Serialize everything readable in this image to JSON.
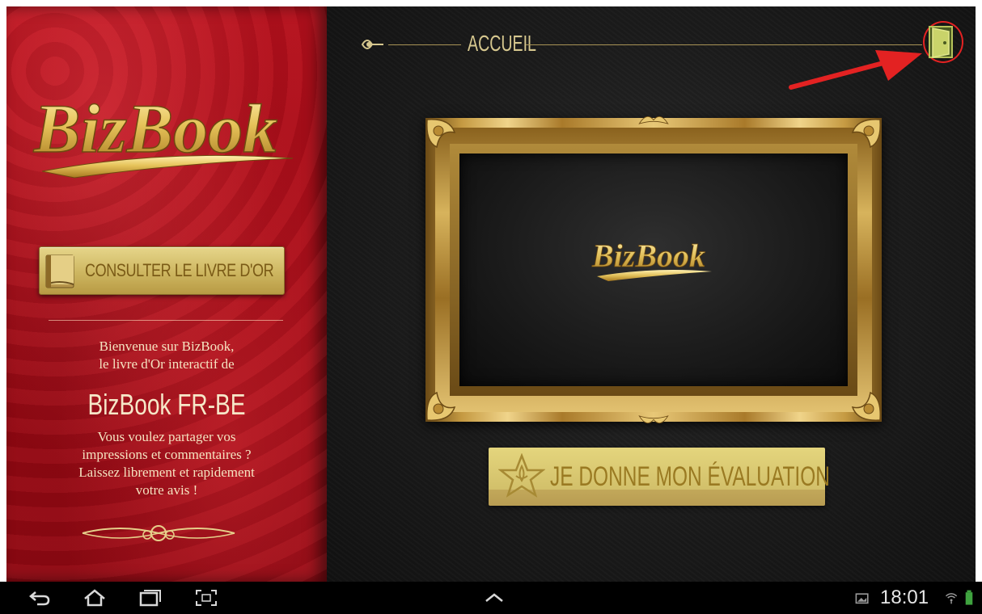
{
  "app": {
    "brand": "BizBook"
  },
  "sidebar": {
    "consult_button": "CONSULTER LE LIVRE D'OR",
    "welcome_line1": "Bienvenue sur BizBook,",
    "welcome_line2": "le livre d'Or interactif de",
    "company": "BizBook FR-BE",
    "message_line1": "Vous voulez partager vos",
    "message_line2": "impressions et commentaires ?",
    "message_line3": "Laissez librement et rapidement",
    "message_line4": "votre avis !"
  },
  "header": {
    "title": "ACCUEIL",
    "exit_icon": "door-exit-icon"
  },
  "main": {
    "frame_logo": "BizBook",
    "rate_button": "JE DONNE MON ÉVALUATION"
  },
  "status_bar": {
    "time": "18:01"
  },
  "colors": {
    "sidebar_red": "#a10b16",
    "gold": "#d6c78e",
    "button_gold": "#d2c06a",
    "annotation_red": "#e32222",
    "background_dark": "#1a1a1a"
  }
}
